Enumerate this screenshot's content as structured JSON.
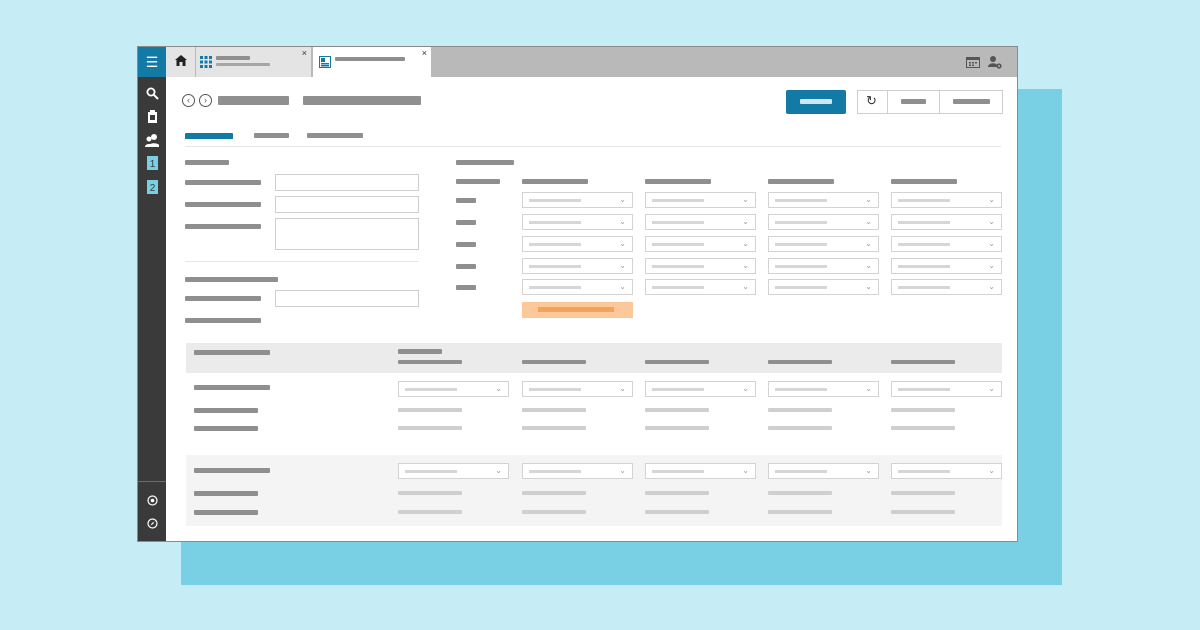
{
  "colors": {
    "accent": "#137aa6",
    "warning": "#fcc89a",
    "rail": "#3a3a3a",
    "page_bg": "#c6ecf5",
    "backdrop": "#79d0e5"
  },
  "icons": {
    "menu": "hamburger-icon",
    "search": "search-icon",
    "clipboard": "clipboard-icon",
    "users": "users-icon",
    "doc1": "document-1-icon",
    "doc2": "document-2-icon",
    "settings": "settings-icon",
    "compass": "compass-icon",
    "home": "home-icon",
    "grid": "grid-app-icon",
    "form": "form-app-icon",
    "calendar": "calendar-icon",
    "user-settings": "user-settings-icon",
    "refresh": "refresh-icon",
    "back": "back-icon",
    "forward": "forward-icon",
    "close": "close-icon",
    "chevron": "chevron-down-icon"
  },
  "glyphs": {
    "menu": "☰",
    "back": "‹",
    "forward": "›",
    "close": "×",
    "chevron": "⌄",
    "refresh": "↻"
  },
  "rail_labels": {
    "doc1": "1",
    "doc2": "2"
  }
}
